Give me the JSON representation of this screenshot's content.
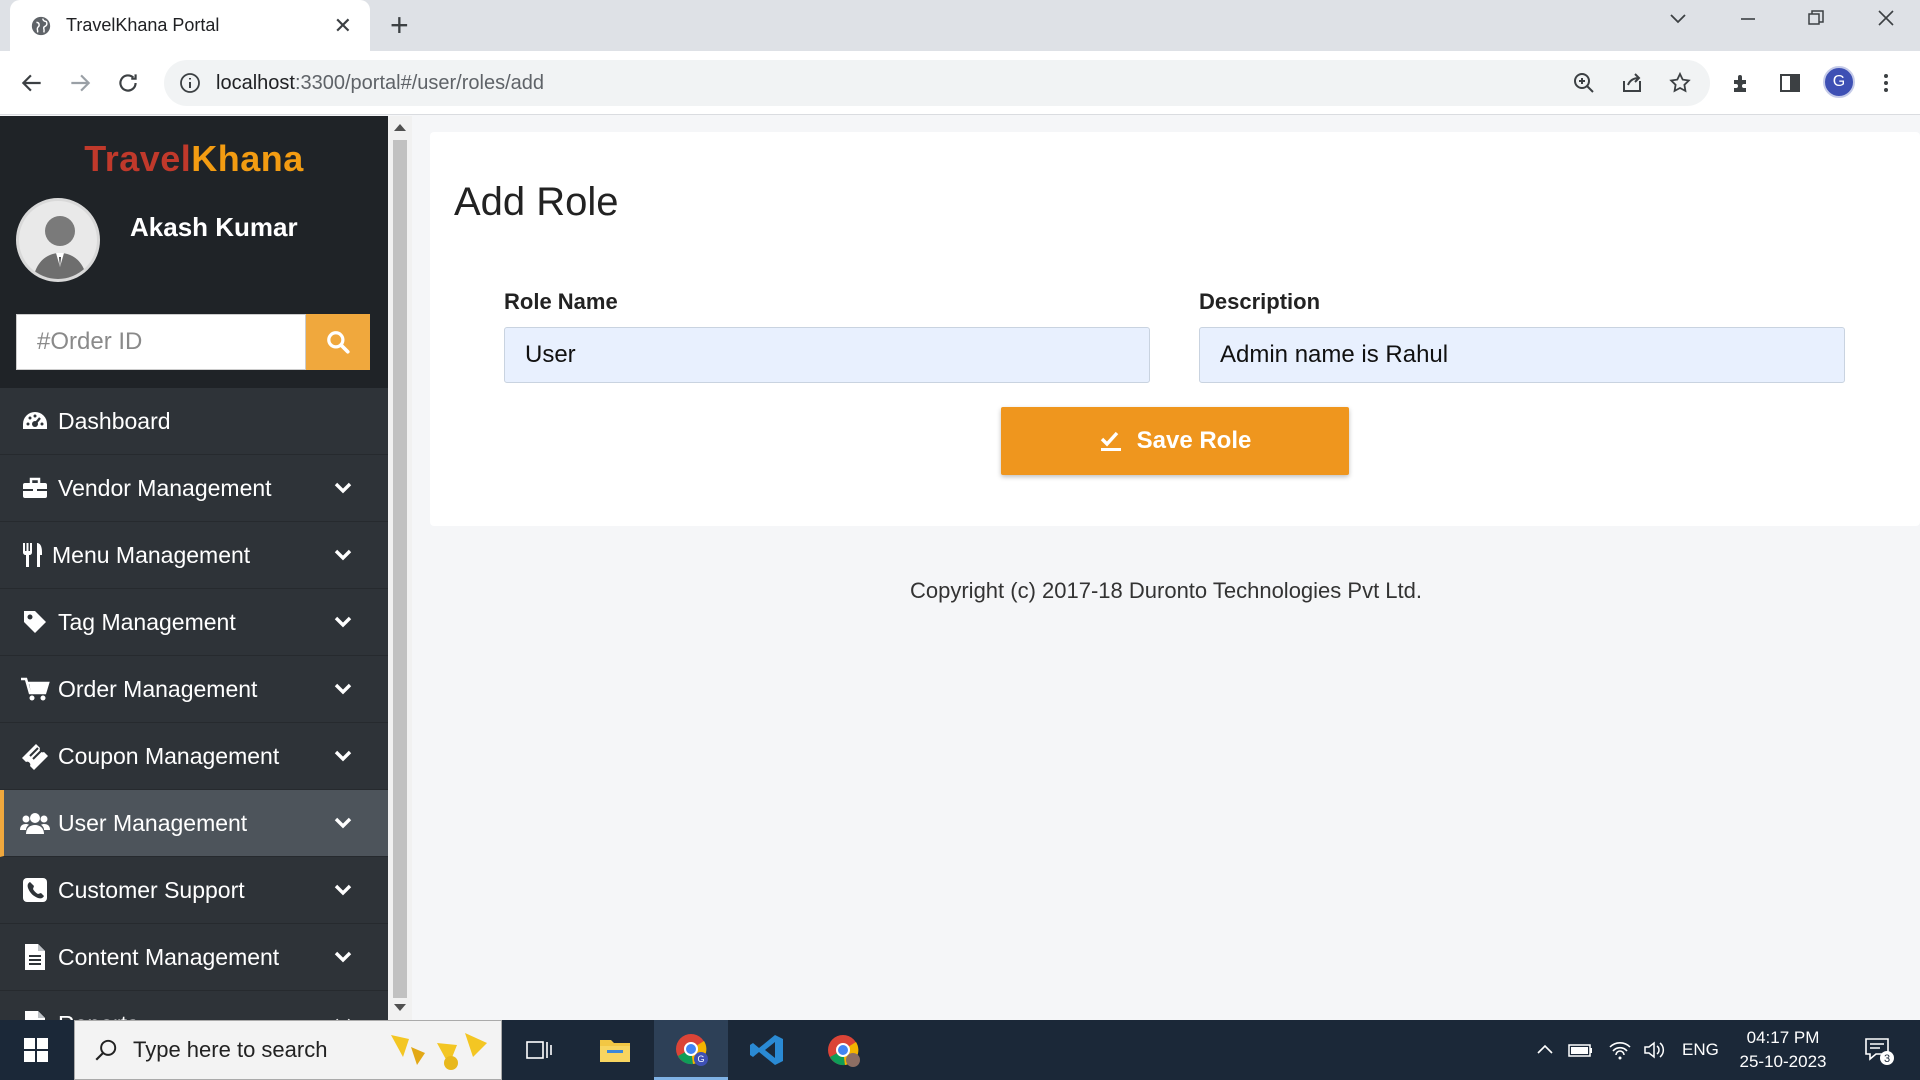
{
  "browser": {
    "tab_title": "TravelKhana Portal",
    "url_host": "localhost",
    "url_rest": ":3300/portal#/user/roles/add",
    "profile_initial": "G"
  },
  "sidebar": {
    "logo_part1": "Travel",
    "logo_part2": "Khana",
    "user_name": "Akash Kumar",
    "order_search_placeholder": "#Order ID",
    "items": [
      {
        "label": "Dashboard",
        "icon": "dashboard-icon"
      },
      {
        "label": "Vendor Management",
        "icon": "briefcase-icon"
      },
      {
        "label": "Menu Management",
        "icon": "utensils-icon"
      },
      {
        "label": "Tag Management",
        "icon": "tag-icon"
      },
      {
        "label": "Order Management",
        "icon": "cart-icon"
      },
      {
        "label": "Coupon Management",
        "icon": "ticket-icon"
      },
      {
        "label": "User Management",
        "icon": "users-icon",
        "active": true
      },
      {
        "label": "Customer Support",
        "icon": "phone-icon"
      },
      {
        "label": "Content Management",
        "icon": "file-icon"
      },
      {
        "label": "Reports",
        "icon": "report-icon"
      }
    ]
  },
  "main": {
    "title": "Add Role",
    "role_name_label": "Role Name",
    "role_name_value": "User",
    "description_label": "Description",
    "description_value": "Admin name is Rahul",
    "save_label": "Save Role",
    "copyright": "Copyright (c) 2017-18 Duronto Technologies Pvt Ltd."
  },
  "taskbar": {
    "search_placeholder": "Type here to search",
    "language": "ENG",
    "time": "04:17 PM",
    "date": "25-10-2023",
    "notification_count": "3"
  },
  "colors": {
    "accent": "#ef961e",
    "sidebar_bg": "#2e3338",
    "logo_red": "#c0392b",
    "logo_orange": "#f39c12"
  }
}
